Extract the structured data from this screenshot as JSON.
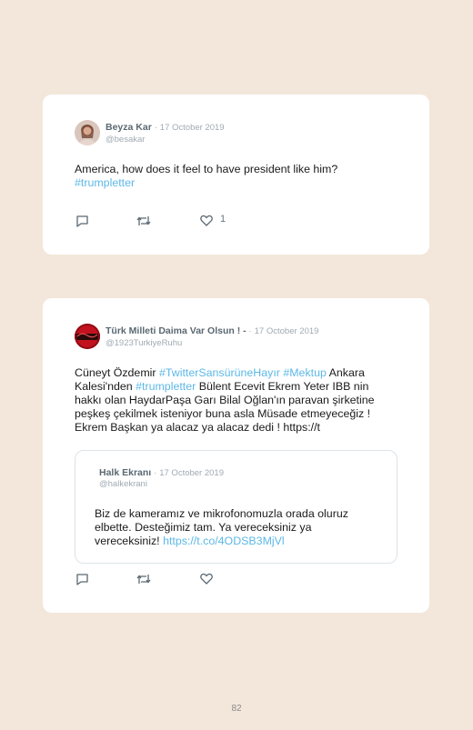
{
  "tweets": [
    {
      "name": "Beyza Kar",
      "date": "17 October 2019",
      "handle": "@besakar",
      "text_lines": [
        "America, how does it feel to have president like him?"
      ],
      "hashtag": "#trumpletter",
      "likes": "1"
    },
    {
      "name": "Türk Milleti Daima Var Olsun ! -",
      "date": "17 October 2019",
      "handle": "@1923TurkiyeRuhu",
      "line1_a": "Cüneyt Özdemir ",
      "line1_tag1": "#TwitterSansürüneHayır",
      "line1_b": " ",
      "line1_tag2": "#Mektup",
      "line1_c": " Ankara",
      "line2_a": "Kalesi'nden ",
      "line2_tag": "#trumpletter",
      "line2_b": " Bülent Ecevit Ekrem Yeter IBB nin",
      "line3": "hakkı olan HaydarPaşa Garı Bilal Oğlan'ın paravan şirketine",
      "line4": "peşkeş çekilmek isteniyor buna asla Müsade etmeyeceğiz !",
      "line5": "Ekrem Başkan ya alacaz ya alacaz dedi ! https://t",
      "quote": {
        "name": "Halk Ekranı",
        "date": "17 October 2019",
        "handle": "@halkekrani",
        "line1": "Biz de kameramız ve mikrofonomuzla orada oluruz",
        "line2": "elbette. Desteğimiz tam. Ya vereceksiniz ya",
        "line3_a": "vereceksiniz! ",
        "line3_link": "https://t.co/4ODSB3MjVl"
      }
    }
  ],
  "separator": "·",
  "page_number": "82",
  "colors": {
    "background": "#f3e7dc",
    "hashtag": "#5cb8e6",
    "name": "#5a6872",
    "meta": "#a0aab2"
  }
}
